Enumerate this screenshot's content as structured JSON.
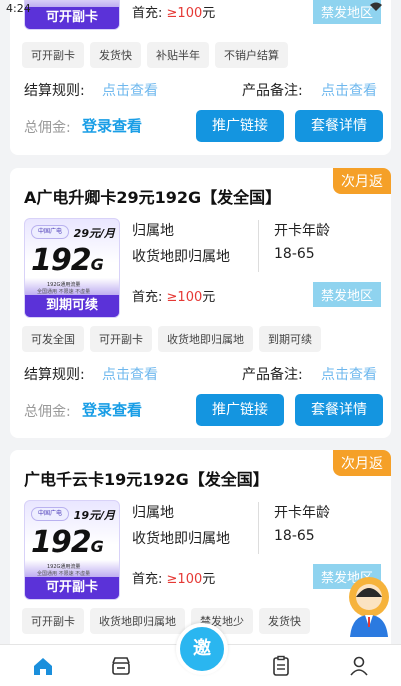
{
  "status_bar": {
    "time": "4:24"
  },
  "labels": {
    "first_recharge": "首充:",
    "yuan": "元",
    "settlement_rule": "结算规则:",
    "product_note": "产品备注:",
    "click_view": "点击查看",
    "commission": "总佣金:",
    "login_view": "登录查看",
    "promo_link": "推广链接",
    "package_detail": "套餐详情",
    "belong": "归属地",
    "ship_belong": "收货地即归属地",
    "age": "开卡年龄",
    "age_range": "18-65",
    "brand": "中国广电",
    "sub_line1": "192G通用流量",
    "sub_line2": "全国通用 不限速 不虚量"
  },
  "cards": [
    {
      "title": "",
      "ribbon": "",
      "thumb_price": "",
      "thumb_big": "",
      "thumb_bar": "可开副卡",
      "topup": "≥100",
      "badge": "禁发地区",
      "tags": [
        "可开副卡",
        "发货快",
        "补贴半年",
        "不销户结算"
      ]
    },
    {
      "title": "A广电升卿卡29元192G【发全国】",
      "ribbon": "次月返",
      "thumb_price": "29元/月",
      "thumb_big": "192",
      "thumb_bar": "到期可续",
      "topup": "≥100",
      "badge": "禁发地区",
      "tags": [
        "可发全国",
        "可开副卡",
        "收货地即归属地",
        "到期可续"
      ]
    },
    {
      "title": "广电千云卡19元192G【发全国】",
      "ribbon": "次月返",
      "thumb_price": "19元/月",
      "thumb_big": "192",
      "thumb_bar": "可开副卡",
      "topup": "≥100",
      "badge": "禁发地区",
      "tags": [
        "可开副卡",
        "收货地即归属地",
        "禁发地少",
        "发货快"
      ]
    }
  ],
  "tabbar": {
    "invite": "邀"
  },
  "colors": {
    "accent": "#1495e0",
    "ribbon": "#f5a028",
    "badge": "#8fd3ef",
    "thumb": "#5b32d8"
  }
}
